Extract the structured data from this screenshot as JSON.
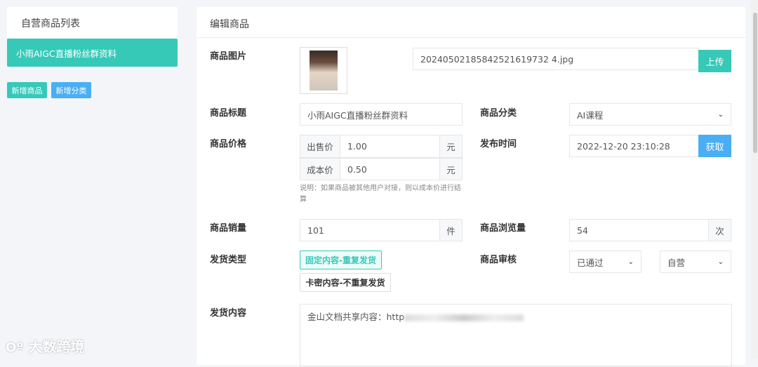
{
  "sidebar": {
    "title": "自营商品列表",
    "items": [
      {
        "label": "小雨AIGC直播粉丝群资料"
      }
    ],
    "add_product": "新增商品",
    "add_category": "新增分类"
  },
  "editor": {
    "title": "编辑商品",
    "image": {
      "label": "商品图片",
      "filename": "20240502185842521619732 4.jpg",
      "upload": "上传"
    },
    "title_field": {
      "label": "商品标题",
      "value": "小雨AIGC直播粉丝群资料"
    },
    "category": {
      "label": "商品分类",
      "value": "AI课程"
    },
    "price": {
      "label": "商品价格",
      "sale_label": "出售价",
      "sale_value": "1.00",
      "cost_label": "成本价",
      "cost_value": "0.50",
      "unit": "元",
      "note": "说明：如果商品被其他用户对接，则以成本价进行结算"
    },
    "publish_time": {
      "label": "发布时间",
      "value": "2022-12-20 23:10:28",
      "fetch": "获取"
    },
    "sales": {
      "label": "商品销量",
      "value": "101",
      "unit": "件"
    },
    "views": {
      "label": "商品浏览量",
      "value": "54",
      "unit": "次"
    },
    "ship_type": {
      "label": "发货类型",
      "options": [
        "固定内容-重复发货",
        "卡密内容-不重复发货"
      ]
    },
    "review": {
      "label": "商品审核",
      "status": "已通过",
      "type": "自营"
    },
    "content": {
      "label": "发货内容",
      "value": "金山文档共享内容：http"
    }
  },
  "watermark": "大数跨境",
  "colors": {
    "teal": "#36c9b8",
    "blue": "#4aaef5"
  }
}
